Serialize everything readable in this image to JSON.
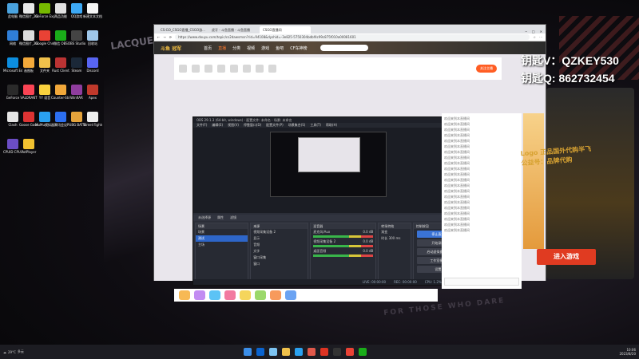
{
  "desktop": {
    "icons": [
      {
        "label": "此电脑",
        "color": "#4aa3df"
      },
      {
        "label": "微信图片_2023...",
        "color": "#e8e8e8"
      },
      {
        "label": "GeForce Experience",
        "color": "#76b900"
      },
      {
        "label": "两品功能",
        "color": "#e0e0e0"
      },
      {
        "label": "QQ游戏",
        "color": "#3da9f5"
      },
      {
        "label": "新建文本文档",
        "color": "#f5f5f5"
      },
      {
        "label": "网络",
        "color": "#2f7ed8"
      },
      {
        "label": "微信图片_2023...",
        "color": "#dcdcdc"
      },
      {
        "label": "Google Chrome",
        "color": "#e94235"
      },
      {
        "label": "微信 OBS",
        "color": "#1aad19"
      },
      {
        "label": "OBS Studio",
        "color": "#444"
      },
      {
        "label": "回收站",
        "color": "#9fc7ea"
      },
      {
        "label": "Microsoft Edge",
        "color": "#0c8ee0"
      },
      {
        "label": "画图板",
        "color": "#f3a93a"
      },
      {
        "label": "文件夹",
        "color": "#f0c14b"
      },
      {
        "label": "Rust Client",
        "color": "#b33"
      },
      {
        "label": "Steam",
        "color": "#1b2838"
      },
      {
        "label": "Discord",
        "color": "#5865f2"
      },
      {
        "label": "GeForce",
        "color": "#2a2a2a"
      },
      {
        "label": "VALORANT",
        "color": "#fa4454"
      },
      {
        "label": "YY 语音",
        "color": "#f9d13e"
      },
      {
        "label": "Counter-Strike 2",
        "color": "#f1a83a"
      },
      {
        "label": "WinRAR",
        "color": "#8f3d9e"
      },
      {
        "label": "Apex",
        "color": "#c0392b"
      },
      {
        "label": "Clash",
        "color": "#e5e5e5"
      },
      {
        "label": "Goose Goose Duck",
        "color": "#d33"
      },
      {
        "label": "MuMu模拟器",
        "color": "#2aa1f0"
      },
      {
        "label": "腾讯会议",
        "color": "#2c6ff0"
      },
      {
        "label": "PUBG BATTLEGROUNDS",
        "color": "#e5a33b"
      },
      {
        "label": "Street Fighter 6",
        "color": "#eee"
      },
      {
        "label": "CPUID CPU-Z",
        "color": "#6b4dc4"
      },
      {
        "label": "PotPlayer",
        "color": "#f2c230"
      }
    ]
  },
  "browser": {
    "tabs": [
      "CS:GO_CSGO直播_CSGO游...",
      "虎牙 - 斗鱼直播 - 斗鱼直播",
      "CSGO直播间"
    ],
    "url": "https://www.douyu.com/topic/cs2dawsmsn?rid=94108&dyshid=-3e825-5750304bdbf4c99c875f010a00081601",
    "nav_items": [
      "首页",
      "直播",
      "分类",
      "视频",
      "游戏",
      "鱼吧",
      "CF车神榜"
    ],
    "logo": "斗鱼 冠军",
    "follow_label": "关注主播"
  },
  "obs": {
    "title": "OBS 29.1.3 (64-bit, windows) - 配置文件: 未命名 - 场景: 未命名",
    "menu": [
      "文件(F)",
      "编辑(E)",
      "视图(V)",
      "停靠窗口(D)",
      "配置文件(P)",
      "场景集合(S)",
      "工具(T)",
      "帮助(H)"
    ],
    "scene_bar": [
      "未选择源",
      "属性",
      "滤镜"
    ],
    "docks": {
      "scenes": {
        "title": "场景",
        "items": [
          "场景",
          "测试",
          "主场"
        ],
        "selected": 1
      },
      "sources": {
        "title": "来源",
        "items": [
          "视频采集设备 2",
          "显示",
          "音频",
          "文字",
          "窗口采集",
          "窗口"
        ]
      },
      "mixer": {
        "title": "混音器",
        "rows": [
          "麦克风/Aux",
          "视频采集设备 2",
          "桌面音频"
        ],
        "levels": [
          "0.0 dB",
          "0.0 dB",
          "0.0 dB"
        ]
      },
      "transitions": {
        "title": "转场特效",
        "mode": "渐变",
        "duration_label": "时长",
        "duration": "300 ms"
      },
      "controls": {
        "title": "控制按钮",
        "buttons": [
          "停止直播",
          "开始录制",
          "启动虚拟摄像机",
          "工作室模式",
          "设置",
          "退出"
        ]
      }
    },
    "status": [
      "LIVE: 00:00:00",
      "REC: 00:00:00",
      "CPU: 1.2%, 60.00 fps"
    ]
  },
  "chat": {
    "lines": [
      "欢迎来到本直播间",
      "欢迎来到本直播间",
      "欢迎来到本直播间",
      "欢迎来到本直播间",
      "欢迎来到本直播间",
      "欢迎来到本直播间",
      "欢迎来到本直播间",
      "欢迎来到本直播间",
      "欢迎来到本直播间",
      "欢迎来到本直播间",
      "欢迎来到本直播间",
      "欢迎来到本直播间",
      "欢迎来到本直播间",
      "欢迎来到本直播间",
      "欢迎来到本直播间",
      "欢迎来到本直播间",
      "欢迎来到本直播间",
      "欢迎来到本直播间",
      "欢迎来到本直播间",
      "欢迎来到本直播间",
      "欢迎来到本直播间"
    ]
  },
  "overlay": {
    "key_v": "钥匙V：QZKEY530",
    "key_q": "钥匙Q: 862732454",
    "panel_text_1": "Logo 正品国外代购半飞",
    "panel_text_2": "公益号：品牌代购",
    "enter_button": "进入游戏"
  },
  "wallpaper": {
    "brand": "LACQUER THINNER",
    "slogan": "FOR THOSE WHO DARE"
  },
  "taskbar": {
    "left_temp": "29°C",
    "left_weather": "多云",
    "time": "10:06",
    "date": "2023/8/20",
    "pinned_colors": [
      "#0a64d0",
      "#7cc3f2",
      "#f0c14b",
      "#2aa1f0",
      "#e0584a",
      "#d32",
      "#333",
      "#e94235",
      "#1aad19"
    ]
  }
}
